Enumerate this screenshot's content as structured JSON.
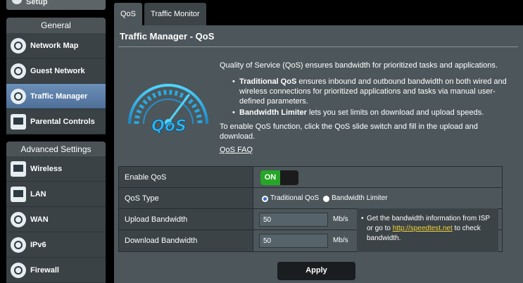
{
  "sidebar": {
    "top_item": "Setup",
    "general_header": "General",
    "general_items": [
      {
        "label": "Network Map"
      },
      {
        "label": "Guest Network"
      },
      {
        "label": "Traffic Manager",
        "active": true
      },
      {
        "label": "Parental Controls"
      }
    ],
    "advanced_header": "Advanced Settings",
    "advanced_items": [
      {
        "label": "Wireless"
      },
      {
        "label": "LAN"
      },
      {
        "label": "WAN"
      },
      {
        "label": "IPv6"
      },
      {
        "label": "Firewall"
      }
    ]
  },
  "tabs": [
    {
      "label": "QoS",
      "active": true
    },
    {
      "label": "Traffic Monitor"
    }
  ],
  "page": {
    "title": "Traffic Manager - QoS",
    "intro": "Quality of Service (QoS) ensures bandwidth for prioritized tasks and applications.",
    "bullets": [
      {
        "bold": "Traditional QoS",
        "text": " ensures inbound and outbound bandwidth on both wired and wireless connections for prioritized applications and tasks via manual user-defined parameters."
      },
      {
        "bold": "Bandwidth Limiter",
        "text": " lets you set limits on download and upload speeds."
      }
    ],
    "enable_hint": "To enable QoS function, click the QoS slide switch and fill in the upload and download.",
    "faq_link": "QoS FAQ",
    "gauge_text": "QoS"
  },
  "settings": {
    "enable_qos_label": "Enable QoS",
    "enable_qos_state": "ON",
    "qos_type_label": "QoS Type",
    "qos_type_options": [
      {
        "label": "Traditional QoS",
        "checked": true
      },
      {
        "label": "Bandwidth Limiter",
        "checked": false
      }
    ],
    "upload_label": "Upload Bandwidth",
    "upload_value": "50",
    "upload_unit": "Mb/s",
    "download_label": "Download Bandwidth",
    "download_value": "50",
    "download_unit": "Mb/s",
    "note_pre": "Get the bandwidth information from ISP or go to ",
    "note_link": "http://speedtest.net",
    "note_post": " to check bandwidth."
  },
  "apply_label": "Apply",
  "colors": {
    "active_nav": "#5d7ea8",
    "toggle_on": "#26a626",
    "link_yellow": "#f5d23a",
    "panel_bg": "#4d575b"
  }
}
